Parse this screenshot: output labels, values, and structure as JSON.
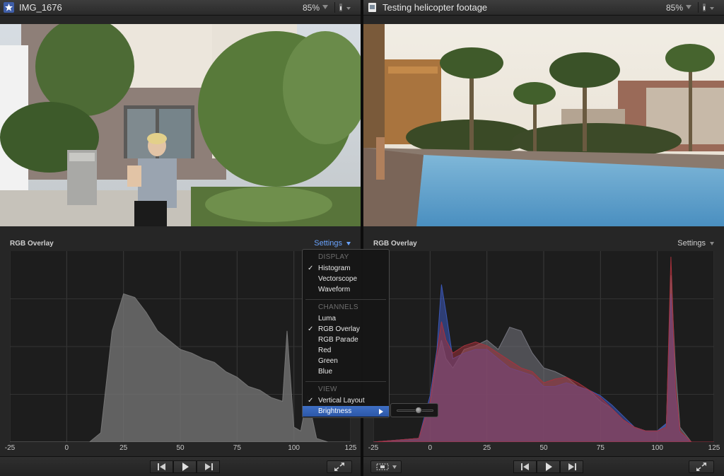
{
  "left_viewer": {
    "title": "IMG_1676",
    "zoom": "85%",
    "scope_title": "RGB Overlay",
    "settings_label": "Settings"
  },
  "right_viewer": {
    "title": "Testing helicopter footage",
    "zoom": "85%",
    "scope_title": "RGB Overlay",
    "settings_label": "Settings"
  },
  "axis_ticks": [
    "-25",
    "0",
    "25",
    "50",
    "75",
    "100",
    "125"
  ],
  "settings_menu": {
    "section_display": "DISPLAY",
    "display_items": [
      {
        "label": "Histogram",
        "checked": true
      },
      {
        "label": "Vectorscope",
        "checked": false
      },
      {
        "label": "Waveform",
        "checked": false
      }
    ],
    "section_channels": "CHANNELS",
    "channel_items": [
      {
        "label": "Luma",
        "checked": false
      },
      {
        "label": "RGB Overlay",
        "checked": true
      },
      {
        "label": "RGB Parade",
        "checked": false
      },
      {
        "label": "Red",
        "checked": false
      },
      {
        "label": "Green",
        "checked": false
      },
      {
        "label": "Blue",
        "checked": false
      }
    ],
    "section_view": "VIEW",
    "view_items": [
      {
        "label": "Vertical Layout",
        "checked": true
      },
      {
        "label": "Brightness",
        "checked": false,
        "highlighted": true
      }
    ],
    "check_glyph": "✓",
    "brightness_level": 0.6
  },
  "icons": {
    "left_title_icon": "star-icon",
    "right_title_icon": "clip-icon",
    "transport": [
      "skip-back-icon",
      "play-icon",
      "skip-forward-icon"
    ],
    "fullscreen": "fullscreen-icon",
    "view_options": "view-options-icon"
  },
  "colors": {
    "accent": "#6aa4ff",
    "menu_highlight": "#3465b8",
    "red_channel": "#c8343c",
    "green_channel": "#3aa85a",
    "blue_channel": "#3a5ac8"
  },
  "chart_data": [
    {
      "type": "area",
      "x": [
        -25,
        0,
        10,
        15,
        20,
        25,
        30,
        35,
        40,
        45,
        50,
        55,
        60,
        65,
        70,
        75,
        80,
        85,
        90,
        95,
        97,
        100,
        103,
        106,
        110,
        115,
        125
      ],
      "series": [
        {
          "values": [
            0,
            0,
            0,
            5,
            60,
            80,
            78,
            70,
            60,
            55,
            50,
            48,
            45,
            43,
            38,
            35,
            30,
            28,
            24,
            22,
            60,
            8,
            6,
            25,
            2,
            0,
            0
          ]
        }
      ],
      "xlim": [
        -25,
        125
      ],
      "ylim": [
        0,
        100
      ],
      "grid": true
    },
    {
      "type": "area",
      "x": [
        -25,
        -5,
        0,
        3,
        5,
        7,
        10,
        15,
        20,
        25,
        30,
        35,
        40,
        45,
        50,
        55,
        60,
        65,
        70,
        75,
        80,
        85,
        90,
        95,
        100,
        104,
        106,
        108,
        110,
        115,
        125
      ],
      "series": [
        {
          "values": [
            0,
            2,
            20,
            45,
            55,
            45,
            40,
            50,
            52,
            55,
            50,
            62,
            60,
            48,
            40,
            38,
            35,
            30,
            28,
            22,
            18,
            12,
            8,
            6,
            6,
            10,
            90,
            40,
            8,
            0,
            0
          ]
        },
        {
          "values": [
            0,
            2,
            25,
            50,
            85,
            70,
            45,
            48,
            50,
            50,
            45,
            40,
            38,
            36,
            30,
            30,
            32,
            30,
            28,
            25,
            20,
            14,
            8,
            6,
            6,
            10,
            80,
            25,
            5,
            0,
            0
          ]
        },
        {
          "values": [
            0,
            2,
            22,
            48,
            65,
            55,
            48,
            52,
            54,
            52,
            48,
            44,
            40,
            38,
            32,
            34,
            35,
            32,
            28,
            24,
            18,
            12,
            8,
            6,
            6,
            8,
            100,
            30,
            6,
            0,
            0
          ]
        }
      ],
      "xlim": [
        -25,
        125
      ],
      "ylim": [
        0,
        100
      ],
      "grid": true
    }
  ]
}
